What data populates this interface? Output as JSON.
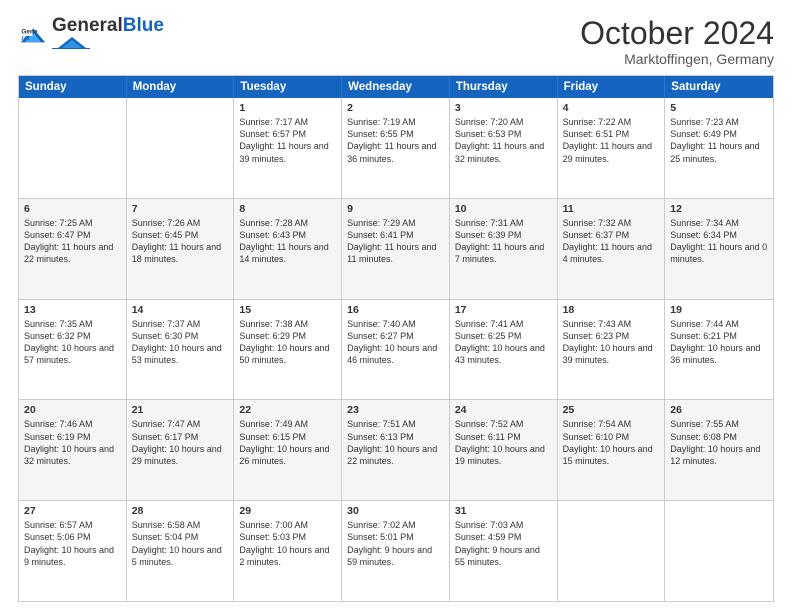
{
  "header": {
    "logo_general": "General",
    "logo_blue": "Blue",
    "month": "October 2024",
    "location": "Marktoffingen, Germany"
  },
  "days_of_week": [
    "Sunday",
    "Monday",
    "Tuesday",
    "Wednesday",
    "Thursday",
    "Friday",
    "Saturday"
  ],
  "rows": [
    {
      "alt": false,
      "cells": [
        {
          "day": "",
          "text": ""
        },
        {
          "day": "",
          "text": ""
        },
        {
          "day": "1",
          "text": "Sunrise: 7:17 AM\nSunset: 6:57 PM\nDaylight: 11 hours and 39 minutes."
        },
        {
          "day": "2",
          "text": "Sunrise: 7:19 AM\nSunset: 6:55 PM\nDaylight: 11 hours and 36 minutes."
        },
        {
          "day": "3",
          "text": "Sunrise: 7:20 AM\nSunset: 6:53 PM\nDaylight: 11 hours and 32 minutes."
        },
        {
          "day": "4",
          "text": "Sunrise: 7:22 AM\nSunset: 6:51 PM\nDaylight: 11 hours and 29 minutes."
        },
        {
          "day": "5",
          "text": "Sunrise: 7:23 AM\nSunset: 6:49 PM\nDaylight: 11 hours and 25 minutes."
        }
      ]
    },
    {
      "alt": true,
      "cells": [
        {
          "day": "6",
          "text": "Sunrise: 7:25 AM\nSunset: 6:47 PM\nDaylight: 11 hours and 22 minutes."
        },
        {
          "day": "7",
          "text": "Sunrise: 7:26 AM\nSunset: 6:45 PM\nDaylight: 11 hours and 18 minutes."
        },
        {
          "day": "8",
          "text": "Sunrise: 7:28 AM\nSunset: 6:43 PM\nDaylight: 11 hours and 14 minutes."
        },
        {
          "day": "9",
          "text": "Sunrise: 7:29 AM\nSunset: 6:41 PM\nDaylight: 11 hours and 11 minutes."
        },
        {
          "day": "10",
          "text": "Sunrise: 7:31 AM\nSunset: 6:39 PM\nDaylight: 11 hours and 7 minutes."
        },
        {
          "day": "11",
          "text": "Sunrise: 7:32 AM\nSunset: 6:37 PM\nDaylight: 11 hours and 4 minutes."
        },
        {
          "day": "12",
          "text": "Sunrise: 7:34 AM\nSunset: 6:34 PM\nDaylight: 11 hours and 0 minutes."
        }
      ]
    },
    {
      "alt": false,
      "cells": [
        {
          "day": "13",
          "text": "Sunrise: 7:35 AM\nSunset: 6:32 PM\nDaylight: 10 hours and 57 minutes."
        },
        {
          "day": "14",
          "text": "Sunrise: 7:37 AM\nSunset: 6:30 PM\nDaylight: 10 hours and 53 minutes."
        },
        {
          "day": "15",
          "text": "Sunrise: 7:38 AM\nSunset: 6:29 PM\nDaylight: 10 hours and 50 minutes."
        },
        {
          "day": "16",
          "text": "Sunrise: 7:40 AM\nSunset: 6:27 PM\nDaylight: 10 hours and 46 minutes."
        },
        {
          "day": "17",
          "text": "Sunrise: 7:41 AM\nSunset: 6:25 PM\nDaylight: 10 hours and 43 minutes."
        },
        {
          "day": "18",
          "text": "Sunrise: 7:43 AM\nSunset: 6:23 PM\nDaylight: 10 hours and 39 minutes."
        },
        {
          "day": "19",
          "text": "Sunrise: 7:44 AM\nSunset: 6:21 PM\nDaylight: 10 hours and 36 minutes."
        }
      ]
    },
    {
      "alt": true,
      "cells": [
        {
          "day": "20",
          "text": "Sunrise: 7:46 AM\nSunset: 6:19 PM\nDaylight: 10 hours and 32 minutes."
        },
        {
          "day": "21",
          "text": "Sunrise: 7:47 AM\nSunset: 6:17 PM\nDaylight: 10 hours and 29 minutes."
        },
        {
          "day": "22",
          "text": "Sunrise: 7:49 AM\nSunset: 6:15 PM\nDaylight: 10 hours and 26 minutes."
        },
        {
          "day": "23",
          "text": "Sunrise: 7:51 AM\nSunset: 6:13 PM\nDaylight: 10 hours and 22 minutes."
        },
        {
          "day": "24",
          "text": "Sunrise: 7:52 AM\nSunset: 6:11 PM\nDaylight: 10 hours and 19 minutes."
        },
        {
          "day": "25",
          "text": "Sunrise: 7:54 AM\nSunset: 6:10 PM\nDaylight: 10 hours and 15 minutes."
        },
        {
          "day": "26",
          "text": "Sunrise: 7:55 AM\nSunset: 6:08 PM\nDaylight: 10 hours and 12 minutes."
        }
      ]
    },
    {
      "alt": false,
      "cells": [
        {
          "day": "27",
          "text": "Sunrise: 6:57 AM\nSunset: 5:06 PM\nDaylight: 10 hours and 9 minutes."
        },
        {
          "day": "28",
          "text": "Sunrise: 6:58 AM\nSunset: 5:04 PM\nDaylight: 10 hours and 5 minutes."
        },
        {
          "day": "29",
          "text": "Sunrise: 7:00 AM\nSunset: 5:03 PM\nDaylight: 10 hours and 2 minutes."
        },
        {
          "day": "30",
          "text": "Sunrise: 7:02 AM\nSunset: 5:01 PM\nDaylight: 9 hours and 59 minutes."
        },
        {
          "day": "31",
          "text": "Sunrise: 7:03 AM\nSunset: 4:59 PM\nDaylight: 9 hours and 55 minutes."
        },
        {
          "day": "",
          "text": ""
        },
        {
          "day": "",
          "text": ""
        }
      ]
    }
  ]
}
